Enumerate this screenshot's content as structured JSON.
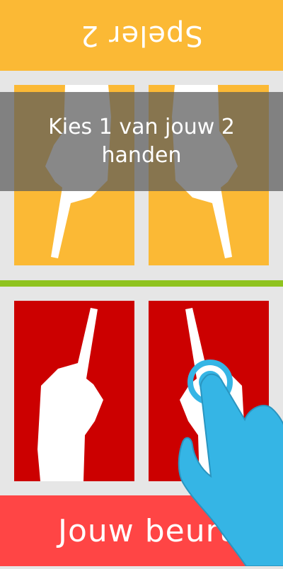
{
  "opponent": {
    "label": "Speler 2"
  },
  "prompt": {
    "text": "Kies 1 van jouw 2 handen"
  },
  "player": {
    "turn_label": "Jouw beurt"
  },
  "hands": {
    "opponent_left_fingers": 1,
    "opponent_right_fingers": 1,
    "player_left_fingers": 1,
    "player_right_fingers": 1
  },
  "colors": {
    "opponent_card": "#fbb935",
    "player_card": "#cc0000",
    "opponent_banner": "#fbb935",
    "player_banner": "#ff4545",
    "divider": "#8fc31f",
    "hint_hand": "#35b5e5"
  },
  "icons": {
    "card_hand": "pointing-hand-icon",
    "tutorial_hand": "tap-hand-icon"
  }
}
